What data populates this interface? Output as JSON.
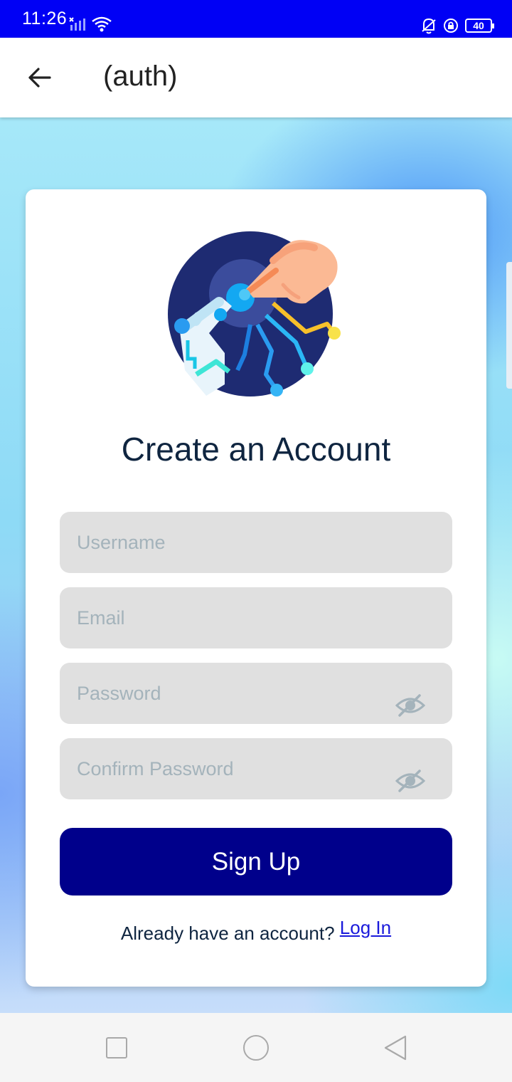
{
  "status_bar": {
    "time": "11:26",
    "battery": "40"
  },
  "app_bar": {
    "title": "(auth)"
  },
  "card": {
    "title": "Create an Account",
    "fields": {
      "username_placeholder": "Username",
      "email_placeholder": "Email",
      "password_placeholder": "Password",
      "confirm_password_placeholder": "Confirm Password"
    },
    "signup_label": "Sign Up",
    "login_prompt": "Already have an account?",
    "login_link": "Log In"
  },
  "colors": {
    "primary_button": "#00008b",
    "status_bar": "#0000f5",
    "link": "#1a1adb"
  },
  "icons": {
    "back": "arrow-left-icon",
    "password_toggle": "eye-off-icon",
    "nav_recents": "square-icon",
    "nav_home": "circle-icon",
    "nav_back": "triangle-back-icon"
  }
}
